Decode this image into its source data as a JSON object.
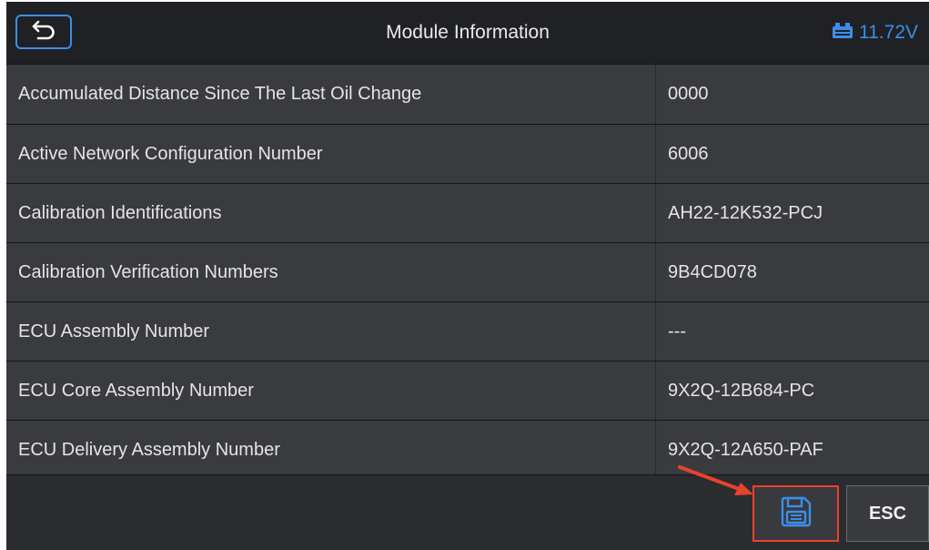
{
  "header": {
    "title": "Module Information",
    "voltage": "11.72V",
    "back_icon": "back-icon",
    "battery_icon": "battery-icon"
  },
  "rows": [
    {
      "label": "Accumulated Distance Since The Last Oil Change",
      "value": "0000"
    },
    {
      "label": "Active Network Configuration Number",
      "value": "6006"
    },
    {
      "label": "Calibration Identifications",
      "value": "AH22-12K532-PCJ"
    },
    {
      "label": "Calibration Verification Numbers",
      "value": "9B4CD078"
    },
    {
      "label": "ECU Assembly Number",
      "value": "---"
    },
    {
      "label": "ECU Core Assembly Number",
      "value": "9X2Q-12B684-PC"
    },
    {
      "label": "ECU Delivery Assembly Number",
      "value": "9X2Q-12A650-PAF"
    }
  ],
  "footer": {
    "save_icon": "save-icon",
    "esc_label": "ESC"
  },
  "colors": {
    "accent": "#3b8ee8",
    "highlight": "#e8432c",
    "background": "#222427",
    "row": "#3a3b3e"
  }
}
